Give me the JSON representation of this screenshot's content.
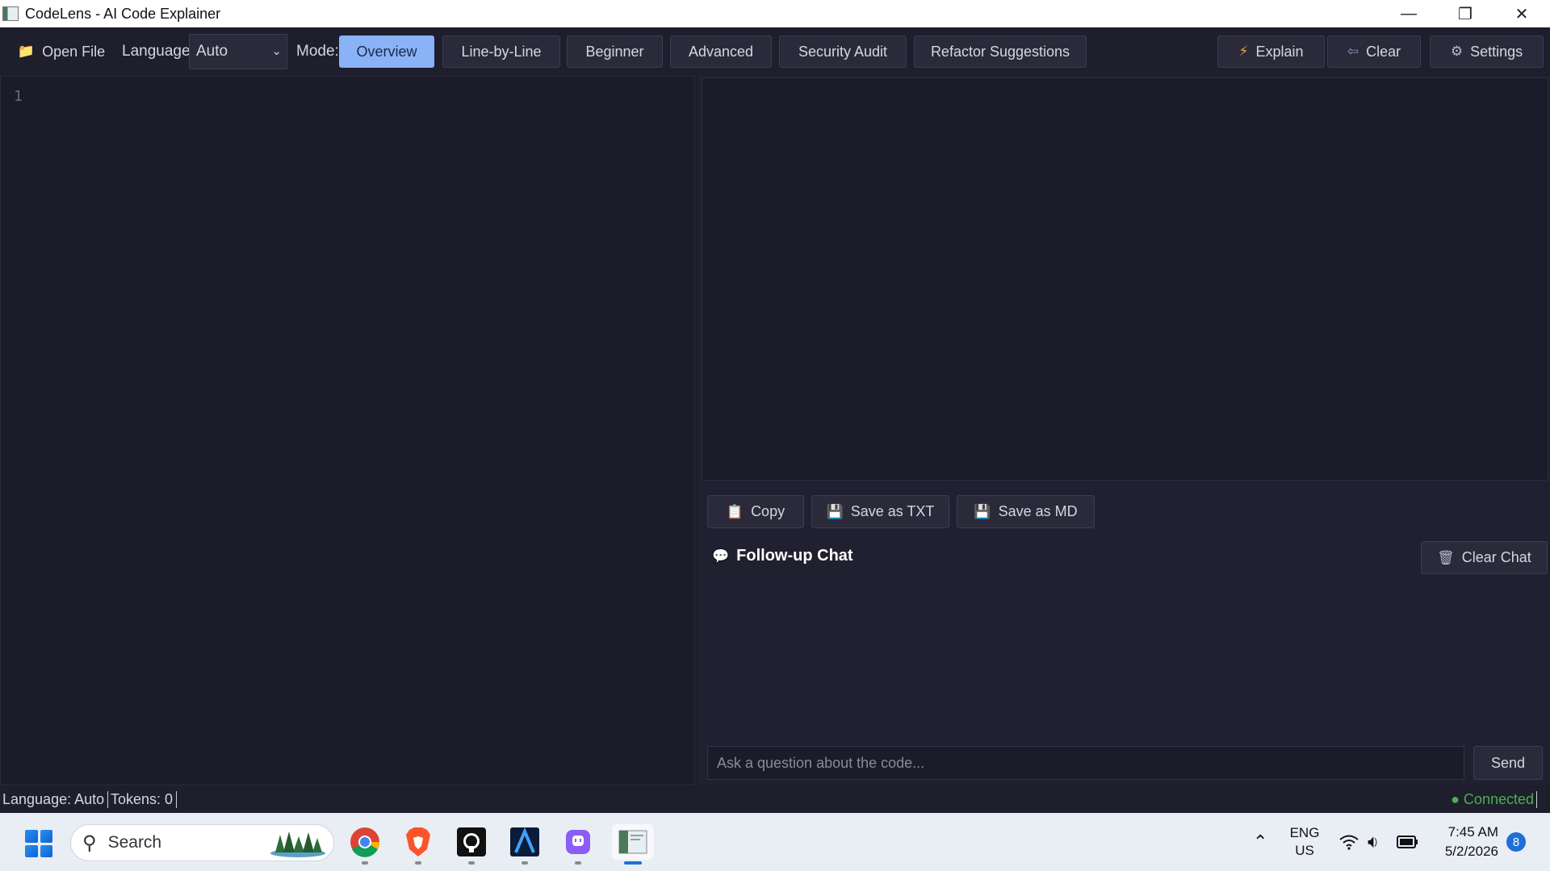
{
  "window": {
    "title": "CodeLens - AI Code Explainer"
  },
  "toolbar": {
    "open_file": "Open File",
    "language_label": "Language:",
    "language_value": "Auto",
    "mode_label": "Mode:",
    "modes": [
      "Overview",
      "Line-by-Line",
      "Beginner",
      "Advanced",
      "Security Audit",
      "Refactor Suggestions"
    ],
    "active_mode": "Overview",
    "explain": "Explain",
    "clear": "Clear",
    "settings": "Settings"
  },
  "editor": {
    "line_numbers": [
      "1"
    ]
  },
  "output_actions": {
    "copy": "Copy",
    "save_txt": "Save as TXT",
    "save_md": "Save as MD"
  },
  "chat": {
    "title": "Follow-up Chat",
    "clear_chat": "Clear Chat",
    "placeholder": "Ask a question about the code...",
    "send": "Send"
  },
  "status": {
    "language": "Language: Auto",
    "tokens": "Tokens: 0",
    "connection": "● Connected"
  },
  "taskbar": {
    "search": "Search",
    "lang_top": "ENG",
    "lang_bottom": "US",
    "time": "7:45 AM",
    "date": "5/2/2026",
    "notifications": "8"
  },
  "colors": {
    "accent": "#8ab2f6",
    "background": "#1c1c2a",
    "connected": "#4caf50"
  }
}
